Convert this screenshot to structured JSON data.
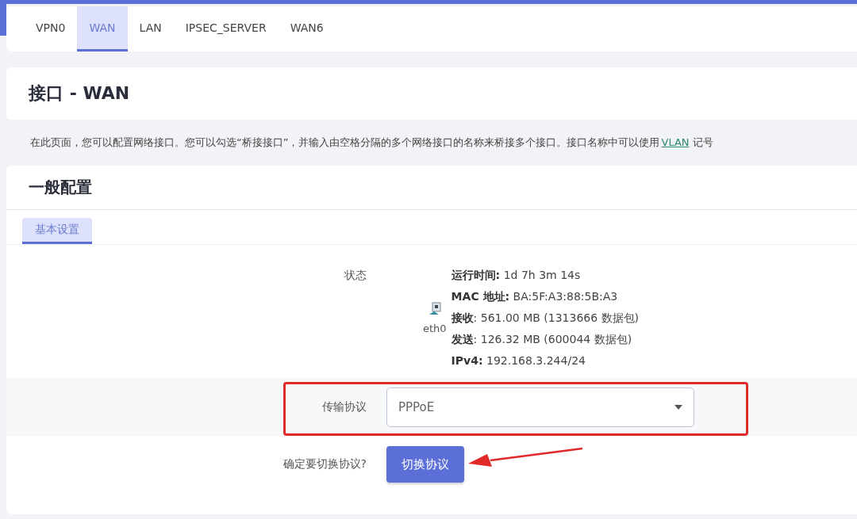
{
  "tabs": [
    {
      "label": "VPN0",
      "selected": false
    },
    {
      "label": "WAN",
      "selected": true
    },
    {
      "label": "LAN",
      "selected": false
    },
    {
      "label": "IPSEC_SERVER",
      "selected": false
    },
    {
      "label": "WAN6",
      "selected": false
    }
  ],
  "page_title": "接口 - WAN",
  "description": {
    "before": "在此页面，您可以配置网络接口。您可以勾选“桥接接口”，并输入由空格分隔的多个网络接口的名称来桥接多个接口。接口名称中可以使用",
    "link": "VLAN",
    "after": "记号"
  },
  "section": {
    "title": "一般配置",
    "subtabs": [
      {
        "label": "基本设置",
        "selected": true
      }
    ]
  },
  "status": {
    "label": "状态",
    "device": "eth0",
    "lines": [
      "**运行时间:** 1d 7h 3m 14s",
      "**MAC 地址:** BA:5F:A3:88:5B:A3",
      "**接收**: 561.00 MB (1313666 数据包)",
      "**发送**: 126.32 MB (600044 数据包)",
      "**IPv4:** 192.168.3.244/24"
    ]
  },
  "protocol": {
    "label": "传输协议",
    "value": "PPPoE"
  },
  "switch": {
    "label": "确定要切换协议?",
    "button": "切换协议"
  }
}
